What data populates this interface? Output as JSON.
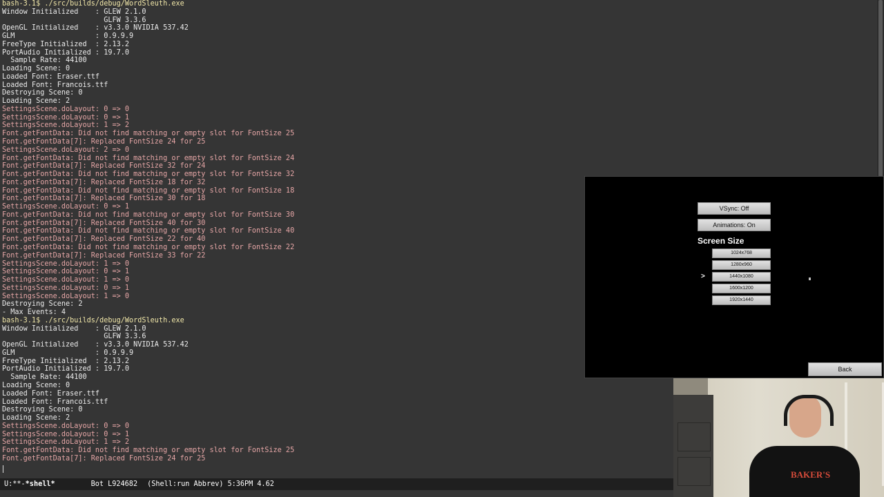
{
  "terminal": {
    "lines": [
      {
        "text": "bash-3.1$ ./src/builds/debug/WordSleuth.exe",
        "style": "prompt"
      },
      {
        "text": "Window Initialized    : GLEW 2.1.0",
        "style": "normal"
      },
      {
        "text": "                        GLFW 3.3.6",
        "style": "normal"
      },
      {
        "text": "OpenGL Initialized    : v3.3.0 NVIDIA 537.42",
        "style": "normal"
      },
      {
        "text": "GLM                   : 0.9.9.9",
        "style": "normal"
      },
      {
        "text": "FreeType Initialized  : 2.13.2",
        "style": "normal"
      },
      {
        "text": "PortAudio Initialized : 19.7.0",
        "style": "normal"
      },
      {
        "text": "  Sample Rate: 44100",
        "style": "normal"
      },
      {
        "text": "Loading Scene: 0",
        "style": "normal"
      },
      {
        "text": "Loaded Font: Eraser.ttf",
        "style": "normal"
      },
      {
        "text": "Loaded Font: Francois.ttf",
        "style": "normal"
      },
      {
        "text": "Destroying Scene: 0",
        "style": "normal"
      },
      {
        "text": "Loading Scene: 2",
        "style": "normal"
      },
      {
        "text": "SettingsScene.doLayout: 0 => 0",
        "style": "log"
      },
      {
        "text": "SettingsScene.doLayout: 0 => 1",
        "style": "log"
      },
      {
        "text": "SettingsScene.doLayout: 1 => 2",
        "style": "log"
      },
      {
        "text": "Font.getFontData: Did not find matching or empty slot for FontSize 25",
        "style": "log"
      },
      {
        "text": "Font.getFontData[7]: Replaced FontSize 24 for 25",
        "style": "log"
      },
      {
        "text": "SettingsScene.doLayout: 2 => 0",
        "style": "log"
      },
      {
        "text": "Font.getFontData: Did not find matching or empty slot for FontSize 24",
        "style": "log"
      },
      {
        "text": "Font.getFontData[7]: Replaced FontSize 32 for 24",
        "style": "log"
      },
      {
        "text": "Font.getFontData: Did not find matching or empty slot for FontSize 32",
        "style": "log"
      },
      {
        "text": "Font.getFontData[7]: Replaced FontSize 18 for 32",
        "style": "log"
      },
      {
        "text": "Font.getFontData: Did not find matching or empty slot for FontSize 18",
        "style": "log"
      },
      {
        "text": "Font.getFontData[7]: Replaced FontSize 30 for 18",
        "style": "log"
      },
      {
        "text": "SettingsScene.doLayout: 0 => 1",
        "style": "log"
      },
      {
        "text": "Font.getFontData: Did not find matching or empty slot for FontSize 30",
        "style": "log"
      },
      {
        "text": "Font.getFontData[7]: Replaced FontSize 40 for 30",
        "style": "log"
      },
      {
        "text": "Font.getFontData: Did not find matching or empty slot for FontSize 40",
        "style": "log"
      },
      {
        "text": "Font.getFontData[7]: Replaced FontSize 22 for 40",
        "style": "log"
      },
      {
        "text": "Font.getFontData: Did not find matching or empty slot for FontSize 22",
        "style": "log"
      },
      {
        "text": "Font.getFontData[7]: Replaced FontSize 33 for 22",
        "style": "log"
      },
      {
        "text": "SettingsScene.doLayout: 1 => 0",
        "style": "log"
      },
      {
        "text": "SettingsScene.doLayout: 0 => 1",
        "style": "log"
      },
      {
        "text": "SettingsScene.doLayout: 1 => 0",
        "style": "log"
      },
      {
        "text": "SettingsScene.doLayout: 0 => 1",
        "style": "log"
      },
      {
        "text": "SettingsScene.doLayout: 1 => 0",
        "style": "log"
      },
      {
        "text": "Destroying Scene: 2",
        "style": "normal"
      },
      {
        "text": "- Max Events: 4",
        "style": "normal"
      },
      {
        "text": "bash-3.1$ ./src/builds/debug/WordSleuth.exe",
        "style": "prompt"
      },
      {
        "text": "Window Initialized    : GLEW 2.1.0",
        "style": "normal"
      },
      {
        "text": "                        GLFW 3.3.6",
        "style": "normal"
      },
      {
        "text": "OpenGL Initialized    : v3.3.0 NVIDIA 537.42",
        "style": "normal"
      },
      {
        "text": "GLM                   : 0.9.9.9",
        "style": "normal"
      },
      {
        "text": "FreeType Initialized  : 2.13.2",
        "style": "normal"
      },
      {
        "text": "PortAudio Initialized : 19.7.0",
        "style": "normal"
      },
      {
        "text": "  Sample Rate: 44100",
        "style": "normal"
      },
      {
        "text": "Loading Scene: 0",
        "style": "normal"
      },
      {
        "text": "Loaded Font: Eraser.ttf",
        "style": "normal"
      },
      {
        "text": "Loaded Font: Francois.ttf",
        "style": "normal"
      },
      {
        "text": "Destroying Scene: 0",
        "style": "normal"
      },
      {
        "text": "Loading Scene: 2",
        "style": "normal"
      },
      {
        "text": "SettingsScene.doLayout: 0 => 0",
        "style": "log"
      },
      {
        "text": "SettingsScene.doLayout: 0 => 1",
        "style": "log"
      },
      {
        "text": "SettingsScene.doLayout: 1 => 2",
        "style": "log"
      },
      {
        "text": "Font.getFontData: Did not find matching or empty slot for FontSize 25",
        "style": "log"
      },
      {
        "text": "Font.getFontData[7]: Replaced FontSize 24 for 25",
        "style": "log"
      }
    ]
  },
  "modeline": {
    "status": "U:**-",
    "buffer": "*shell*",
    "position": "Bot L924682",
    "modes": "(Shell:run Abbrev)",
    "time": "5:36PM",
    "load": "4.62"
  },
  "game": {
    "vsync_label": "VSync: Off",
    "animations_label": "Animations: On",
    "screen_size_label": "Screen Size",
    "resolutions": [
      "1024x768",
      "1280x960",
      "1440x1080",
      "1600x1200",
      "1920x1440"
    ],
    "selected_marker": ">",
    "back_label": "Back"
  },
  "webcam": {
    "shirt_text": "BAKER'S"
  },
  "colors": {
    "terminal_bg": "#353535",
    "prompt": "#f0e6a8",
    "log": "#e6a6a6",
    "normal": "#ececec",
    "game_bg": "#000000",
    "button_bg": "#cfcfcf"
  }
}
